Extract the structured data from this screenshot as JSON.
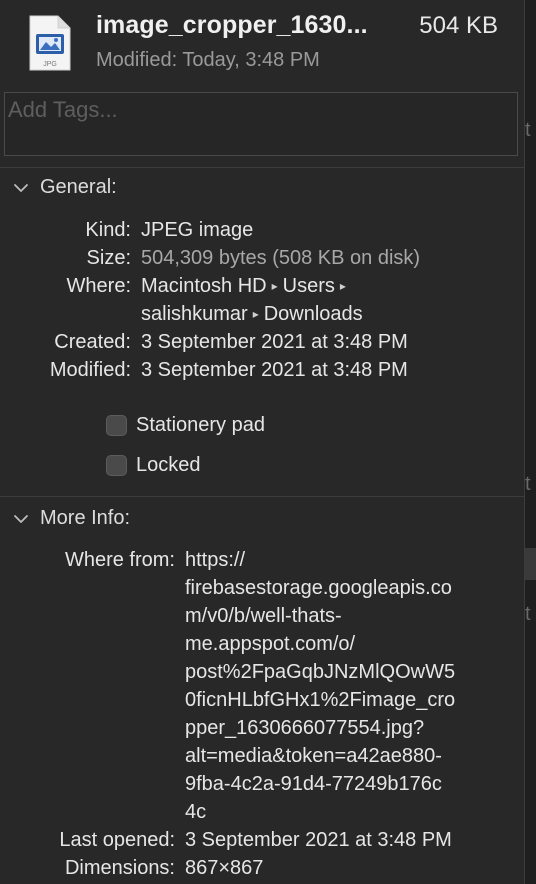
{
  "header": {
    "file_name": "image_cropper_1630...",
    "file_size": "504 KB",
    "modified": "Modified: Today, 3:48 PM",
    "file_type_badge": "JPG",
    "icon": "jpeg-document-icon"
  },
  "tags": {
    "placeholder": "Add Tags..."
  },
  "general": {
    "title": "General:",
    "kind_label": "Kind:",
    "kind_value": "JPEG image",
    "size_label": "Size:",
    "size_value": "504,309 bytes (508 KB on disk)",
    "where_label": "Where:",
    "where_path": [
      "Macintosh HD",
      "Users",
      "salishkumar",
      "Downloads"
    ],
    "path_separator": "▸",
    "created_label": "Created:",
    "created_value": "3 September 2021 at 3:48 PM",
    "modified_label": "Modified:",
    "modified_value": "3 September 2021 at 3:48 PM",
    "stationery_label": "Stationery pad",
    "stationery_checked": false,
    "locked_label": "Locked",
    "locked_checked": false
  },
  "more_info": {
    "title": "More Info:",
    "where_from_label": "Where from:",
    "where_from_lines": [
      "https://",
      "firebasestorage.googleapis.co",
      "m/v0/b/well-thats-",
      "me.appspot.com/o/",
      "post%2FpaGqbJNzMlQOwW5",
      "0ficnHLbfGHx1%2Fimage_cro",
      "pper_1630666077554.jpg?",
      "alt=media&token=a42ae880-",
      "9fba-4c2a-91d4-77249b176c",
      "4c"
    ],
    "last_opened_label": "Last opened:",
    "last_opened_value": "3 September 2021 at 3:48 PM",
    "dimensions_label": "Dimensions:",
    "dimensions_value": "867×867"
  },
  "background_window": {
    "fragment_char": "t"
  },
  "colors": {
    "panel_bg": "#282828",
    "text": "#e6e6e6",
    "muted_text": "#9a9a9a",
    "separator": "#3c3c3c",
    "checkbox_fill": "#4a4a4a"
  }
}
